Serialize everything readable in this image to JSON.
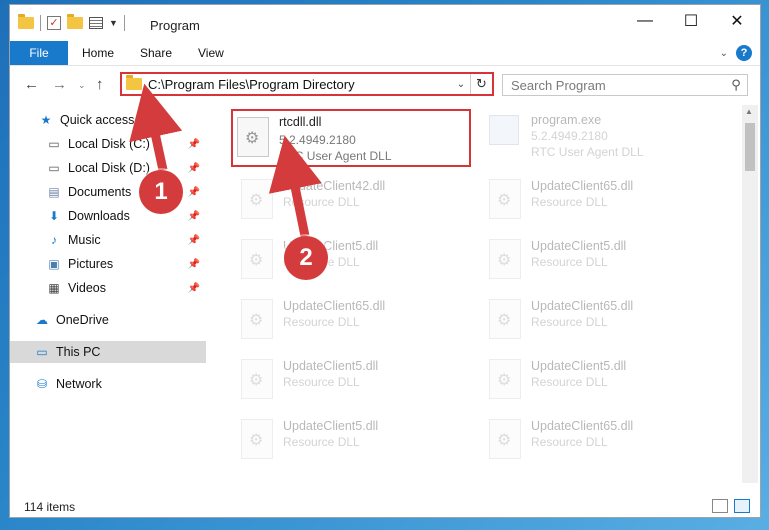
{
  "window": {
    "title": "Program"
  },
  "controls": {
    "minimize": "—",
    "maximize": "☐",
    "close": "✕"
  },
  "ribbon": {
    "file": "File",
    "home": "Home",
    "share": "Share",
    "view": "View",
    "help": "?"
  },
  "address": {
    "path": "C:\\Program Files\\Program Directory"
  },
  "search": {
    "placeholder": "Search Program"
  },
  "navpane": {
    "items": [
      {
        "label": "Quick access",
        "icon": "star-icon"
      },
      {
        "label": "Local Disk (C:)",
        "icon": "drive-icon"
      },
      {
        "label": "Local Disk (D:)",
        "icon": "drive-icon"
      },
      {
        "label": "Documents",
        "icon": "document-icon"
      },
      {
        "label": "Downloads",
        "icon": "download-icon"
      },
      {
        "label": "Music",
        "icon": "music-icon"
      },
      {
        "label": "Pictures",
        "icon": "picture-icon"
      },
      {
        "label": "Videos",
        "icon": "video-icon"
      },
      {
        "label": "OneDrive",
        "icon": "cloud-icon"
      },
      {
        "label": "This PC",
        "icon": "computer-icon"
      },
      {
        "label": "Network",
        "icon": "network-icon"
      }
    ]
  },
  "files": {
    "rtc": {
      "name": "rtcdll.dll",
      "version": "5.2.4949.2180",
      "desc": "RTC User Agent DLL"
    },
    "program": {
      "name": "program.exe",
      "version": "5.2.4949.2180",
      "desc": "RTC User Agent DLL"
    },
    "f1": {
      "name": "UpdateClient42.dll",
      "desc": "Resource DLL"
    },
    "f2": {
      "name": "UpdateClient65.dll",
      "desc": "Resource DLL"
    },
    "f3": {
      "name": "UpdateClient5.dll",
      "desc": "Resource DLL"
    },
    "f4": {
      "name": "UpdateClient5.dll",
      "desc": "Resource DLL"
    },
    "f5": {
      "name": "UpdateClient65.dll",
      "desc": "Resource DLL"
    },
    "f6": {
      "name": "UpdateClient65.dll",
      "desc": "Resource DLL"
    },
    "f7": {
      "name": "UpdateClient5.dll",
      "desc": "Resource DLL"
    },
    "f8": {
      "name": "UpdateClient5.dll",
      "desc": "Resource DLL"
    },
    "f9": {
      "name": "UpdateClient5.dll",
      "desc": "Resource DLL"
    },
    "f10": {
      "name": "UpdateClient65.dll",
      "desc": "Resource DLL"
    }
  },
  "status": {
    "count": "114 items"
  },
  "callouts": {
    "one": "1",
    "two": "2"
  },
  "colors": {
    "accent": "#1979ca",
    "highlight": "#d9333a"
  }
}
